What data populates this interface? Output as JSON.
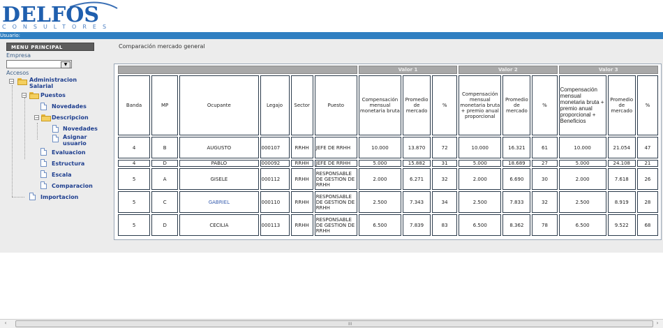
{
  "logo": {
    "brand": "DELFOS",
    "sub": "CONSULTORES"
  },
  "user_label": "Usuario:",
  "sidebar": {
    "menu_title": "MENU PRINCIPAL",
    "empresa_label": "Empresa",
    "empresa_value": "",
    "accesos_label": "Accesos",
    "tree": {
      "administracion": "Administracion Salarial",
      "puestos": "Puestos",
      "novedades": "Novedades",
      "descripcion": "Descripcion",
      "desc_novedades": "Novedades",
      "asignar": "Asignar usuario",
      "evaluacion": "Evaluacion",
      "estructura": "Estructura",
      "escala": "Escala",
      "comparacion": "Comparacion",
      "importacion": "Importacion"
    }
  },
  "content": {
    "title": "Comparación mercado general",
    "groups": [
      "Valor 1",
      "Valor 2",
      "Valor 3"
    ],
    "headers": [
      "Banda",
      "MP",
      "Ocupante",
      "Legajo",
      "Sector",
      "Puesto",
      "Compensación mensual monetaria bruta",
      "Promedio de mercado",
      "%",
      "Compensación mensual monetaria bruta + premio anual proporcional",
      "Promedio de mercado",
      "%",
      "Compensación mensual monetaria bruta + premio anual proporcional + Beneficios",
      "Promedio de mercado",
      "%"
    ],
    "rows": [
      [
        "4",
        "B",
        "AUGUSTO",
        "000107",
        "RRHH",
        "JEFE DE RRHH",
        "10.000",
        "13.870",
        "72",
        "10.000",
        "16.321",
        "61",
        "10.000",
        "21.054",
        "47"
      ],
      [
        "4",
        "D",
        "PABLO",
        "000092",
        "RRHH",
        "JEFE DE RRHH",
        "5.000",
        "15.882",
        "31",
        "5.000",
        "18.689",
        "27",
        "5.000",
        "24.108",
        "21"
      ],
      [
        "5",
        "A",
        "GISELE",
        "000112",
        "RRHH",
        "RESPONSABLE DE GESTION DE RRHH",
        "2.000",
        "6.271",
        "32",
        "2.000",
        "6.690",
        "30",
        "2.000",
        "7.618",
        "26"
      ],
      [
        "5",
        "C",
        "GABRIEL",
        "000110",
        "RRHH",
        "RESPONSABLE DE GESTION DE RRHH",
        "2.500",
        "7.343",
        "34",
        "2.500",
        "7.833",
        "32",
        "2.500",
        "8.919",
        "28"
      ],
      [
        "5",
        "D",
        "CECILIA",
        "000113",
        "RRHH",
        "RESPONSABLE DE GESTION DE RRHH",
        "6.500",
        "7.839",
        "83",
        "6.500",
        "8.362",
        "78",
        "6.500",
        "9.522",
        "68"
      ]
    ]
  },
  "scrollbar": {
    "left": "‹",
    "right": "›",
    "grip": "III"
  }
}
